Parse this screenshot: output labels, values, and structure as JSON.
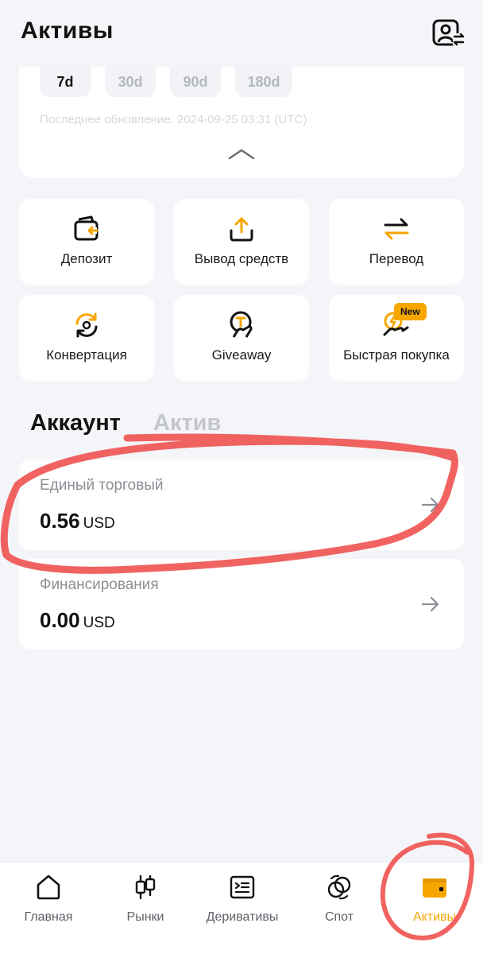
{
  "header": {
    "title": "Активы"
  },
  "top_card": {
    "periods": [
      {
        "label": "7d",
        "active": true
      },
      {
        "label": "30d",
        "active": false
      },
      {
        "label": "90d",
        "active": false
      },
      {
        "label": "180d",
        "active": false
      }
    ],
    "last_update": "Последнее обновление: 2024-09-25 03:31 (UTC)"
  },
  "actions": [
    {
      "label": "Депозит",
      "icon": "deposit-icon"
    },
    {
      "label": "Вывод средств",
      "icon": "withdraw-icon"
    },
    {
      "label": "Перевод",
      "icon": "transfer-icon"
    },
    {
      "label": "Конвертация",
      "icon": "convert-icon"
    },
    {
      "label": "Giveaway",
      "icon": "giveaway-icon"
    },
    {
      "label": "Быстрая покупка",
      "icon": "quick-buy-icon",
      "badge": "New"
    }
  ],
  "tabs": [
    {
      "label": "Аккаунт",
      "active": true
    },
    {
      "label": "Актив",
      "active": false
    }
  ],
  "accounts": [
    {
      "name": "Единый торговый",
      "amount": "0.56",
      "currency": "USD"
    },
    {
      "name": "Финансирования",
      "amount": "0.00",
      "currency": "USD"
    }
  ],
  "bottom_nav": [
    {
      "label": "Главная",
      "icon": "home-icon",
      "active": false
    },
    {
      "label": "Рынки",
      "icon": "candlestick-icon",
      "active": false
    },
    {
      "label": "Деривативы",
      "icon": "derivatives-icon",
      "active": false
    },
    {
      "label": "Спот",
      "icon": "spot-icon",
      "active": false
    },
    {
      "label": "Активы",
      "icon": "wallet-icon",
      "active": true
    }
  ],
  "colors": {
    "accent": "#f7a600",
    "background": "#f4f5f8",
    "card": "#ffffff",
    "annotation": "#f0524f"
  }
}
